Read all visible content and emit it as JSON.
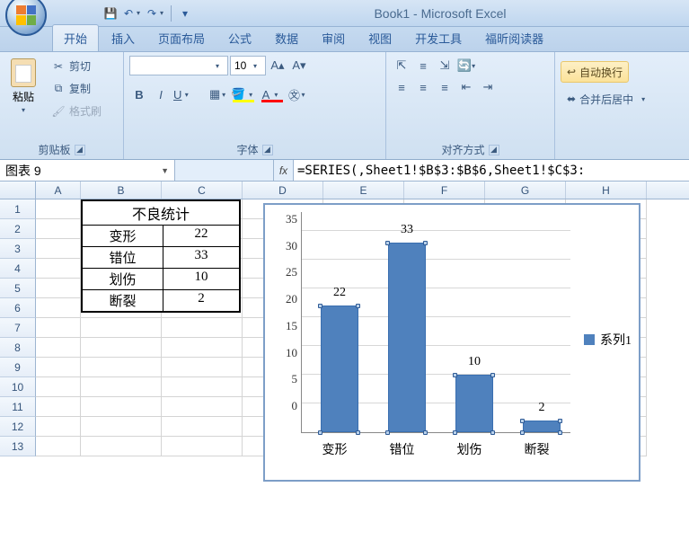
{
  "title": "Book1 - Microsoft Excel",
  "qat": {
    "save": "💾",
    "undo": "↶",
    "redo": "↷"
  },
  "tabs": [
    "开始",
    "插入",
    "页面布局",
    "公式",
    "数据",
    "审阅",
    "视图",
    "开发工具",
    "福昕阅读器"
  ],
  "active_tab": 0,
  "clipboard": {
    "paste": "粘贴",
    "cut": "剪切",
    "copy": "复制",
    "format_painter": "格式刷",
    "label": "剪贴板"
  },
  "font_group": {
    "font_name": "",
    "font_size": "10",
    "label": "字体"
  },
  "align_group": {
    "wrap": "自动换行",
    "merge": "合并后居中",
    "label": "对齐方式"
  },
  "name_box": "图表 9",
  "fx_label": "fx",
  "formula": "=SERIES(,Sheet1!$B$3:$B$6,Sheet1!$C$3:",
  "columns": [
    "A",
    "B",
    "C",
    "D",
    "E",
    "F",
    "G",
    "H"
  ],
  "rows": [
    "1",
    "2",
    "3",
    "4",
    "5",
    "6",
    "7",
    "8",
    "9",
    "10",
    "11",
    "12",
    "13"
  ],
  "sheet_table": {
    "title": "不良统计",
    "rows": [
      {
        "cat": "变形",
        "val": "22"
      },
      {
        "cat": "错位",
        "val": "33"
      },
      {
        "cat": "划伤",
        "val": "10"
      },
      {
        "cat": "断裂",
        "val": "2"
      }
    ]
  },
  "chart_data": {
    "type": "bar",
    "categories": [
      "变形",
      "错位",
      "划伤",
      "断裂"
    ],
    "values": [
      22,
      33,
      10,
      2
    ],
    "series": [
      {
        "name": "系列1",
        "values": [
          22,
          33,
          10,
          2
        ]
      }
    ],
    "ylim": [
      0,
      35
    ],
    "ystep": 5,
    "xlabel": "",
    "ylabel": "",
    "title": ""
  },
  "legend_label": "系列1"
}
